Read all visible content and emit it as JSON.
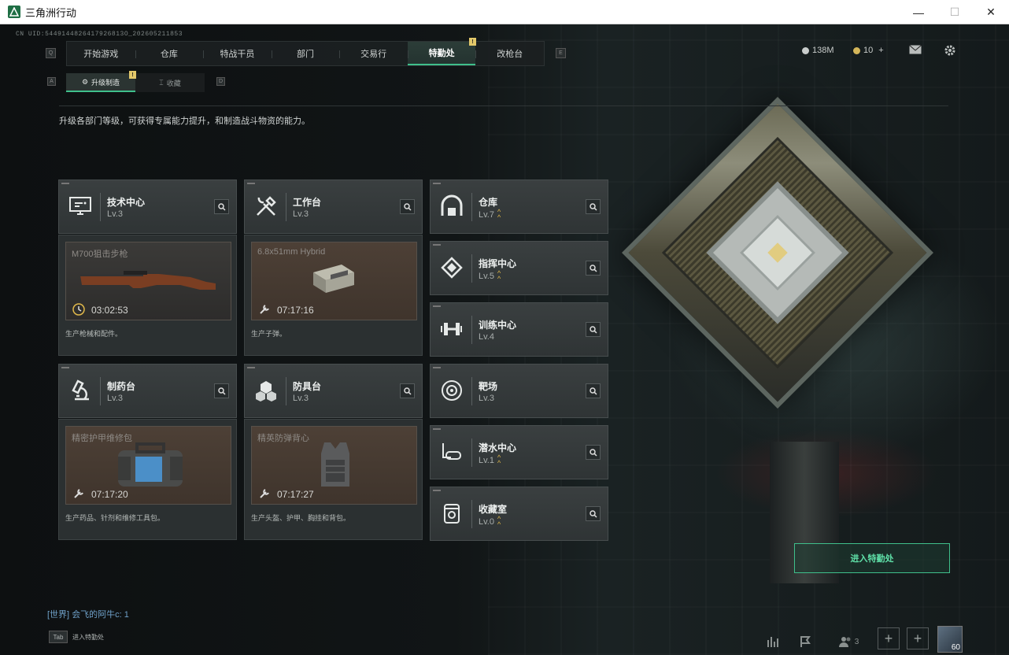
{
  "window": {
    "title": "三角洲行动",
    "minimize": "—",
    "maximize": "☐",
    "close": "✕"
  },
  "uid": "CN UID:5449144826417926813O_202605211853",
  "nav": {
    "key_left": "Q",
    "key_right": "E",
    "tabs": [
      "开始游戏",
      "仓库",
      "特战干员",
      "部门",
      "交易行",
      "特勤处",
      "改枪台"
    ],
    "active": "特勤处",
    "badge": "!"
  },
  "topright": {
    "currency": "138M",
    "tokens": "10",
    "plus": "+"
  },
  "subnav": {
    "key_left": "A",
    "key_right": "D",
    "tabs": [
      "升级制造",
      "收藏"
    ],
    "badge": "!"
  },
  "description": "升级各部门等级，可获得专属能力提升，和制造战斗物资的能力。",
  "stations": [
    {
      "name": "技术中心",
      "level": "Lv.3",
      "icon": "monitor-icon",
      "upgrade": false,
      "product": {
        "name": "M700狙击步枪",
        "timer": "03:02:53",
        "desc": "生产枪械和配件。",
        "style": "dark"
      }
    },
    {
      "name": "工作台",
      "level": "Lv.3",
      "icon": "tools-icon",
      "upgrade": false,
      "product": {
        "name": "6.8x51mm Hybrid",
        "timer": "07:17:16",
        "desc": "生产子弹。",
        "style": "brown"
      }
    },
    {
      "name": "制药台",
      "level": "Lv.3",
      "icon": "microscope-icon",
      "upgrade": false,
      "product": {
        "name": "精密护甲维修包",
        "timer": "07:17:20",
        "desc": "生产药品、针剂和维修工具包。",
        "style": "brown"
      }
    },
    {
      "name": "防具台",
      "level": "Lv.3",
      "icon": "cubes-icon",
      "upgrade": false,
      "product": {
        "name": "精英防弹背心",
        "timer": "07:17:27",
        "desc": "生产头盔、护甲、胸挂和背包。",
        "style": "brown"
      }
    }
  ],
  "facilities": [
    {
      "name": "仓库",
      "level": "Lv.7",
      "icon": "warehouse-icon",
      "upgrade": true
    },
    {
      "name": "指挥中心",
      "level": "Lv.5",
      "icon": "chip-icon",
      "upgrade": true
    },
    {
      "name": "训练中心",
      "level": "Lv.4",
      "icon": "dumbbell-icon",
      "upgrade": false
    },
    {
      "name": "靶场",
      "level": "Lv.3",
      "icon": "target-icon",
      "upgrade": false
    },
    {
      "name": "潜水中心",
      "level": "Lv.1",
      "icon": "diving-mask-icon",
      "upgrade": true
    },
    {
      "name": "收藏室",
      "level": "Lv.0",
      "icon": "trophy-room-icon",
      "upgrade": true
    }
  ],
  "enter_button": "进入特勤处",
  "chat": {
    "channel": "[世界]",
    "message": "会飞的阿牛c: 1"
  },
  "tab_hint": {
    "key": "Tab",
    "label": "进入特勤处"
  },
  "friends_count": "3",
  "avatar_level": "60",
  "colors": {
    "accent": "#3fbf8b",
    "upgrade": "#e0b84a",
    "badge": "#e3c86a"
  }
}
